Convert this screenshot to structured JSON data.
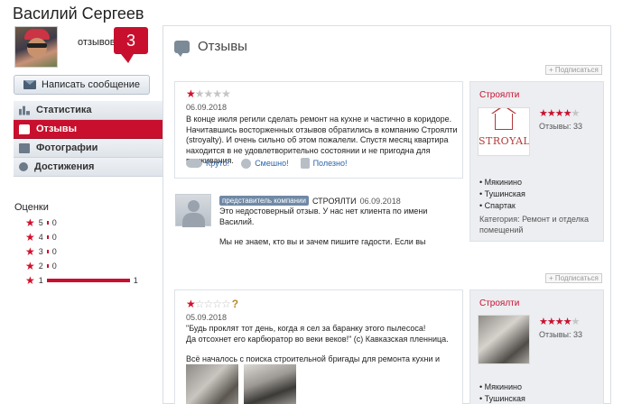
{
  "profile": {
    "name": "Василий Сергеев",
    "reviews_label": "отзывов:",
    "reviews_count": "3",
    "message_button": "Написать сообщение"
  },
  "nav": {
    "items": [
      {
        "label": "Статистика",
        "icon": "stats-icon",
        "active": false
      },
      {
        "label": "Отзывы",
        "icon": "reviews-icon",
        "active": true
      },
      {
        "label": "Фотографии",
        "icon": "photo-icon",
        "active": false
      },
      {
        "label": "Достижения",
        "icon": "award-icon",
        "active": false
      }
    ]
  },
  "ratings": {
    "title": "Оценки",
    "rows": [
      {
        "stars": "5",
        "count": "0",
        "fraction": 0
      },
      {
        "stars": "4",
        "count": "0",
        "fraction": 0
      },
      {
        "stars": "3",
        "count": "0",
        "fraction": 0
      },
      {
        "stars": "2",
        "count": "0",
        "fraction": 0
      },
      {
        "stars": "1",
        "count": "1",
        "fraction": 1
      }
    ]
  },
  "main": {
    "title": "Отзывы",
    "subscribe_label": "+ Подписаться"
  },
  "review1": {
    "rating": 1,
    "date": "06.09.2018",
    "text_lines": [
      "В конце июля регили сделать ремонт на кухне и частично в коридоре.",
      "Начитавшись восторженных отзывов обратились в компанию Строялти",
      "(stroyalty). И очень сильно об этом пожалели. Спустя месяц квартира",
      "находится в не удовлетворительно состоянии и не пригодна для проживания."
    ],
    "actions": [
      "Круто!",
      "Смешно!",
      "Полезно!"
    ]
  },
  "company1": {
    "name": "Строялти",
    "rating": 4.5,
    "reviews_label": "Отзывы: 33",
    "logo_text": "STROYALTY",
    "metro": [
      "Мякинино",
      "Тушинская",
      "Спартак"
    ],
    "category": "Категория: Ремонт и отделка помещений"
  },
  "reply": {
    "tag": "представитель компании",
    "company": "СТРОЯЛТИ",
    "date": "06.09.2018",
    "lines": [
      "Это недостоверный отзыв. У нас нет клиента по имени",
      "Василий.",
      "",
      "Мы не знаем, кто вы и зачем пишите гадости. Если вы"
    ]
  },
  "review2": {
    "rating": 1,
    "question_mark": "?",
    "date": "05.09.2018",
    "text_lines": [
      "\"Будь проклят тот день, когда я сел за баранку этого пылесоса!",
      "Да отсохнет его карбюратор во веки веков!\" (c) Кавказская пленница.",
      "",
      "Всё началось с поиска строительной бригады для ремонта кухни и частично"
    ]
  },
  "company2": {
    "name": "Строялти",
    "rating": 4.5,
    "reviews_label": "Отзывы: 33",
    "metro": [
      "Мякинино",
      "Тушинская"
    ]
  },
  "colors": {
    "accent": "#c8102e",
    "link": "#2a64a8",
    "panel_bg": "#eceef1"
  }
}
